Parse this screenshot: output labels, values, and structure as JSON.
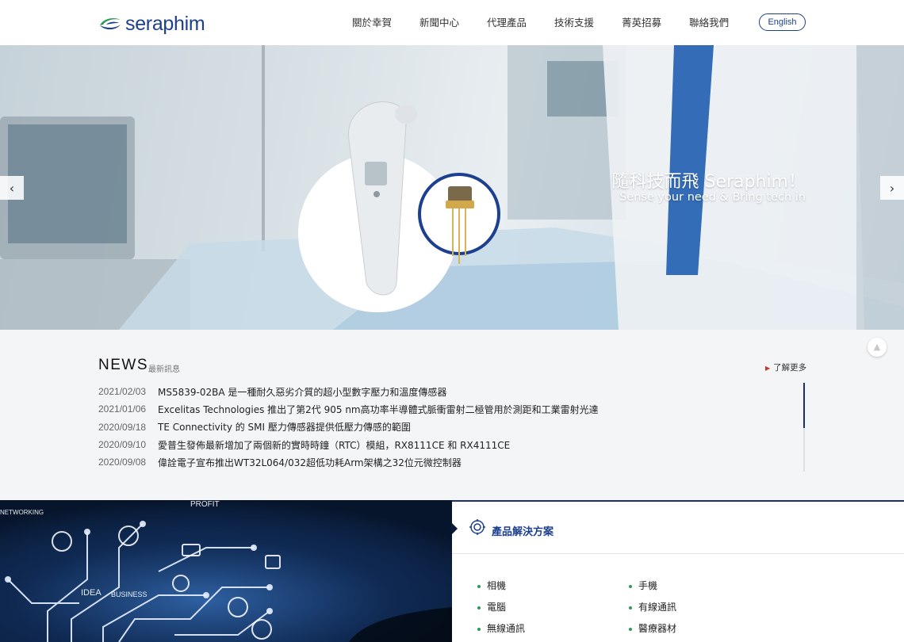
{
  "header": {
    "logo_text": "seraphim",
    "nav": [
      "關於幸賀",
      "新聞中心",
      "代理產品",
      "技術支援",
      "菁英招募",
      "聯絡我們"
    ],
    "language_button": "English"
  },
  "hero": {
    "title": "隨科技而飛 Seraphim！",
    "subtitle": "Sense your need & Bring tech in",
    "prev_icon": "‹",
    "next_icon": "›"
  },
  "news": {
    "title": "NEWS",
    "subtitle": "最新訊息",
    "more_label": "了解更多",
    "items": [
      {
        "date": "2021/02/03",
        "text": "MS5839-02BA 是一種耐久惡劣介質的超小型數字壓力和溫度傳感器"
      },
      {
        "date": "2021/01/06",
        "text": "Excelitas Technologies 推出了第2代 905 nm高功率半導體式脈衝雷射二極管用於測距和工業雷射光達"
      },
      {
        "date": "2020/09/18",
        "text": "TE Connectivity 的 SMI 壓力傳感器提供低壓力傳感的範圍"
      },
      {
        "date": "2020/09/10",
        "text": "愛普生發佈最新增加了兩個新的實時時鐘（RTC）模組，RX8111CE 和 RX4111CE"
      },
      {
        "date": "2020/09/08",
        "text": "偉詮電子宣布推出WT32L064/032超低功耗Arm架構之32位元微控制器"
      }
    ]
  },
  "image_text": {
    "profit": "PROFIT",
    "networking": "NETWORKING",
    "idea": "IDEA",
    "business": "BUSINESS"
  },
  "solutions": {
    "title": "產品解決方案",
    "col1": [
      "相機",
      "電腦",
      "無線通訊"
    ],
    "col2": [
      "手機",
      "有線通訊",
      "醫療器材"
    ]
  },
  "colors": {
    "brand": "#1d3f8f",
    "accent_dark": "#1d2f6f",
    "bullet": "#2e9a57",
    "more_arrow": "#c0392b"
  }
}
